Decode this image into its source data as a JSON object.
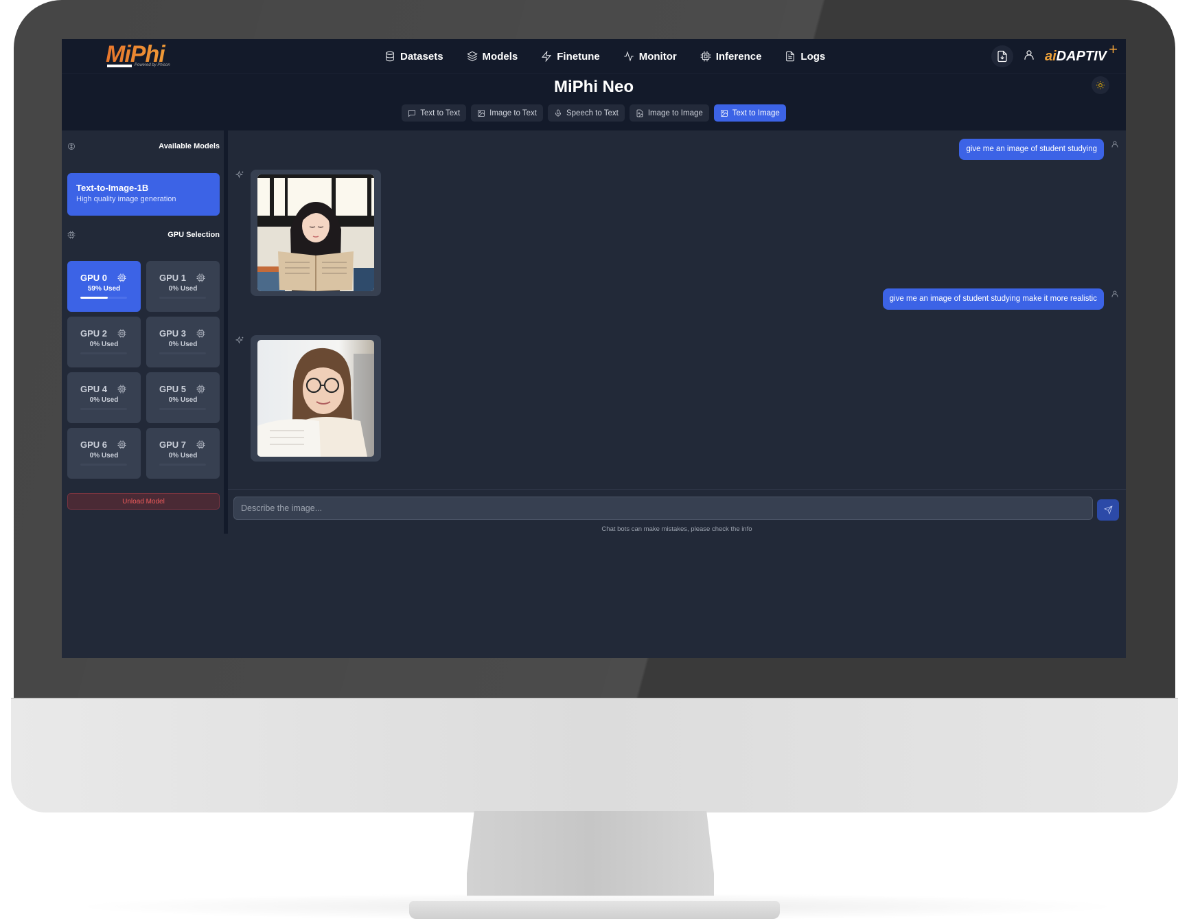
{
  "brand": {
    "logo": "MiPhi",
    "logo_tagline": "Powered by Phison",
    "partner_logo_prefix": "ai",
    "partner_logo_main": "DAPTIV",
    "partner_logo_mark": "+"
  },
  "nav": [
    {
      "label": "Datasets",
      "icon": "database-icon"
    },
    {
      "label": "Models",
      "icon": "layers-icon"
    },
    {
      "label": "Finetune",
      "icon": "zap-icon"
    },
    {
      "label": "Monitor",
      "icon": "activity-icon"
    },
    {
      "label": "Inference",
      "icon": "cpu-icon"
    },
    {
      "label": "Logs",
      "icon": "file-text-icon"
    }
  ],
  "header_actions": {
    "download": "file-download-icon",
    "user": "user-icon",
    "theme": "sun-icon"
  },
  "page_title": "MiPhi Neo",
  "modes": [
    {
      "label": "Text to Text",
      "icon": "message-square-icon",
      "active": false
    },
    {
      "label": "Image to Text",
      "icon": "image-icon",
      "active": false
    },
    {
      "label": "Speech to Text",
      "icon": "mic-icon",
      "active": false
    },
    {
      "label": "Image to Image",
      "icon": "file-image-icon",
      "active": false
    },
    {
      "label": "Text to Image",
      "icon": "image-icon",
      "active": true
    }
  ],
  "sidebar": {
    "models_heading": "Available Models",
    "model": {
      "name": "Text-to-Image-1B",
      "description": "High quality image generation"
    },
    "gpu_heading": "GPU Selection",
    "gpus": [
      {
        "name": "GPU 0",
        "used_label": "59% Used",
        "used": 59,
        "selected": true
      },
      {
        "name": "GPU 1",
        "used_label": "0% Used",
        "used": 0,
        "selected": false
      },
      {
        "name": "GPU 2",
        "used_label": "0% Used",
        "used": 0,
        "selected": false
      },
      {
        "name": "GPU 3",
        "used_label": "0% Used",
        "used": 0,
        "selected": false
      },
      {
        "name": "GPU 4",
        "used_label": "0% Used",
        "used": 0,
        "selected": false
      },
      {
        "name": "GPU 5",
        "used_label": "0% Used",
        "used": 0,
        "selected": false
      },
      {
        "name": "GPU 6",
        "used_label": "0% Used",
        "used": 0,
        "selected": false
      },
      {
        "name": "GPU 7",
        "used_label": "0% Used",
        "used": 0,
        "selected": false
      }
    ],
    "unload_label": "Unload Model"
  },
  "chat": {
    "messages": [
      {
        "role": "user",
        "text": "give me an image of student studying"
      },
      {
        "role": "assistant",
        "image": "illustrated girl with long dark hair reading an open book by a window"
      },
      {
        "role": "user",
        "text": "give me an image of student studying make it more realistic"
      },
      {
        "role": "assistant",
        "image": "photo of smiling young woman with glasses reading a book in a library"
      }
    ],
    "input_placeholder": "Describe the image...",
    "input_value": "",
    "disclaimer": "Chat bots can make mistakes, please check the info"
  }
}
